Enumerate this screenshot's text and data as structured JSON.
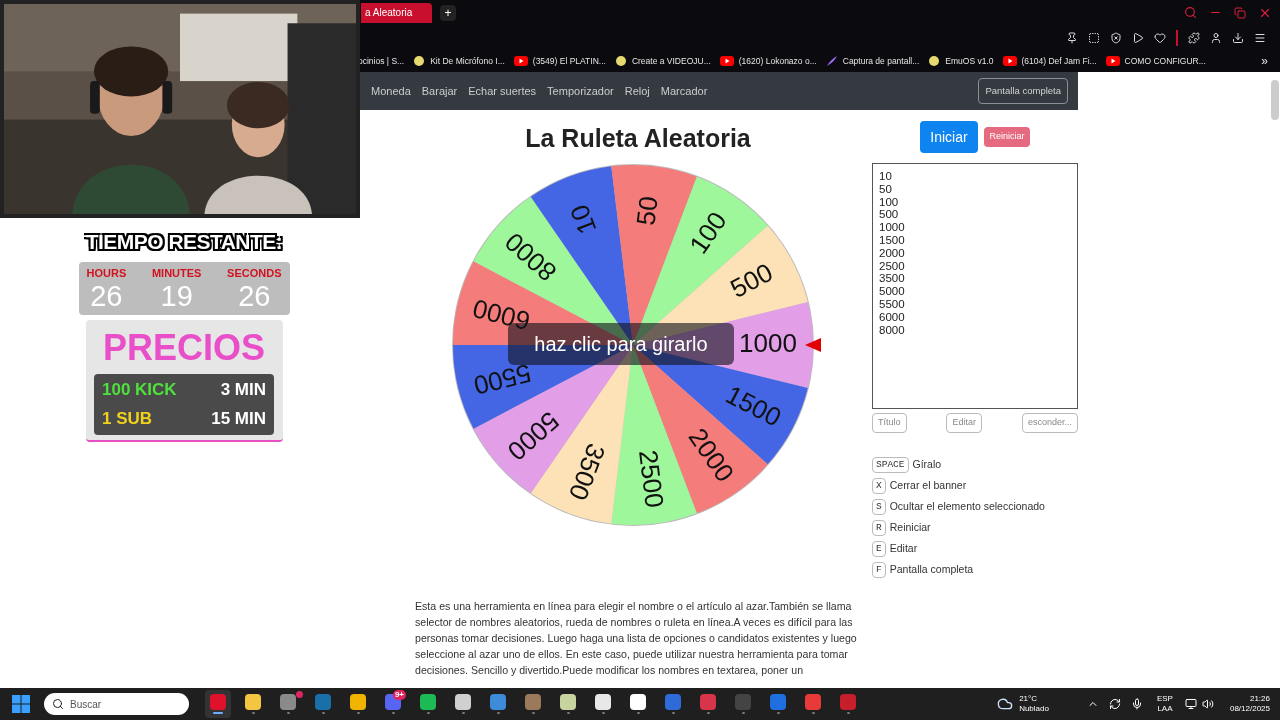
{
  "browser": {
    "tabs": [
      {
        "label": "a Aleatoria",
        "selected": true
      }
    ],
    "new_tab": "+",
    "bookmarks": [
      {
        "label": "ocinios | S...",
        "kind": "none"
      },
      {
        "label": "Kit De Micrófono I...",
        "kind": "site"
      },
      {
        "label": "(3549) El PLATIN...",
        "kind": "youtube"
      },
      {
        "label": "Create a VIDEOJU...",
        "kind": "site"
      },
      {
        "label": "(1620) Lokonazo o...",
        "kind": "youtube"
      },
      {
        "label": "Captura de pantall...",
        "kind": "feather"
      },
      {
        "label": "EmuOS v1.0",
        "kind": "site"
      },
      {
        "label": "(6104) Def Jam Fi...",
        "kind": "youtube"
      },
      {
        "label": "COMO CONFIGUR...",
        "kind": "youtube"
      }
    ],
    "bookmarks_more": "»"
  },
  "overlay": {
    "countdown_title": "TIEMPO RESTANTE:",
    "countdown": [
      {
        "label": "HOURS",
        "value": "26"
      },
      {
        "label": "MINUTES",
        "value": "19"
      },
      {
        "label": "SECONDS",
        "value": "26"
      }
    ],
    "prices_title": "PRECIOS",
    "prices": [
      {
        "item": "100 KICK",
        "color": "#4ee03c",
        "time": "3 MIN"
      },
      {
        "item": "1 SUB",
        "color": "#f2d11e",
        "time": "15 MIN"
      }
    ]
  },
  "navbar": {
    "links": [
      "Moneda",
      "Barajar",
      "Echar suertes",
      "Temporizador",
      "Reloj",
      "Marcador"
    ],
    "fullscreen_button": "Pantalla completa"
  },
  "page": {
    "title": "La Ruleta Aleatoria",
    "wheel": {
      "banner": "haz clic para girarlo",
      "segments": [
        {
          "label": "1000",
          "color": "#e29ee6"
        },
        {
          "label": "1500",
          "color": "#4466e4"
        },
        {
          "label": "2000",
          "color": "#f47c7a"
        },
        {
          "label": "2500",
          "color": "#9ef79a"
        },
        {
          "label": "3500",
          "color": "#fce2b6"
        },
        {
          "label": "5000",
          "color": "#e29ee6"
        },
        {
          "label": "5500",
          "color": "#4466e4"
        },
        {
          "label": "6000",
          "color": "#f47c7a"
        },
        {
          "label": "8000",
          "color": "#9ef79a"
        },
        {
          "label": "10",
          "color": "#4466e4"
        },
        {
          "label": "50",
          "color": "#f47c7a"
        },
        {
          "label": "100",
          "color": "#9ef79a"
        },
        {
          "label": "500",
          "color": "#fce2b6"
        }
      ]
    },
    "start_button": "Iniciar",
    "reset_button": "Reiniciar",
    "entries": [
      "10",
      "50",
      "100",
      "500",
      "1000",
      "1500",
      "2000",
      "2500",
      "3500",
      "5000",
      "5500",
      "6000",
      "8000"
    ],
    "actions": [
      "Título",
      "Editar",
      "esconder..."
    ],
    "shortcuts": [
      {
        "key": "SPACE",
        "label": "Gíralo"
      },
      {
        "key": "X",
        "label": "Cerrar el banner"
      },
      {
        "key": "S",
        "label": "Ocultar el elemento seleccionado"
      },
      {
        "key": "R",
        "label": "Reiniciar"
      },
      {
        "key": "E",
        "label": "Editar"
      },
      {
        "key": "F",
        "label": "Pantalla completa"
      }
    ],
    "description": "Esta es una herramienta en línea para elegir el nombre o el artículo al azar.También se llama selector de nombres aleatorios, rueda de nombres o ruleta en línea.A veces es difícil para las personas tomar decisiones. Luego haga una lista de opciones o candidatos existentes y luego seleccione al azar uno de ellos. En este caso, puede utilizar nuestra herramienta para tomar decisiones. Sencillo y divertido.Puede modificar los nombres en textarea, poner un"
  },
  "taskbar": {
    "search_placeholder": "Buscar",
    "apps": [
      {
        "color": "#e0112b",
        "selected": true
      },
      {
        "color": "#f4c542",
        "selected": false
      },
      {
        "color": "#8a8a8a",
        "selected": false,
        "alert": true
      },
      {
        "color": "#1b6fa8",
        "selected": false
      },
      {
        "color": "#f0b400",
        "selected": false
      },
      {
        "color": "#5865f2",
        "selected": false,
        "badge": "9+"
      },
      {
        "color": "#1db954",
        "selected": false
      },
      {
        "color": "#d0d0d0",
        "selected": false
      },
      {
        "color": "#3d8bd9",
        "selected": false
      },
      {
        "color": "#9a7a5a",
        "selected": false
      },
      {
        "color": "#c8d4a0",
        "selected": false
      },
      {
        "color": "#e8e8e8",
        "selected": false
      },
      {
        "color": "#ffffff",
        "selected": false
      },
      {
        "color": "#2f6bd8",
        "selected": false
      },
      {
        "color": "#d8344a",
        "selected": false
      },
      {
        "color": "#444444",
        "selected": false
      },
      {
        "color": "#1f6fe0",
        "selected": false
      },
      {
        "color": "#e83a3a",
        "selected": false
      },
      {
        "color": "#c81e2a",
        "selected": false
      }
    ],
    "weather": {
      "temp": "21°C",
      "condition": "Nublado"
    },
    "language": [
      "ESP",
      "LAA"
    ],
    "time": "21:26",
    "date": "08/12/2025"
  }
}
